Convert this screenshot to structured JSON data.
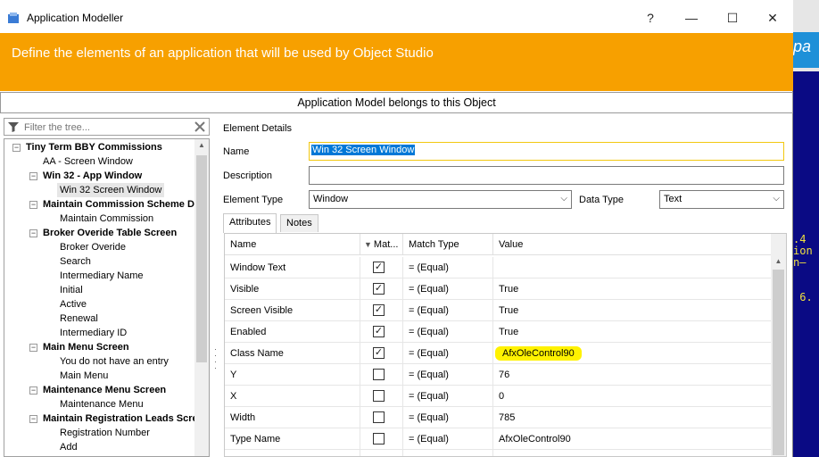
{
  "window": {
    "title": "Application Modeller",
    "help_glyph": "?",
    "minimize_glyph": "—",
    "maximize_glyph": "☐",
    "close_glyph": "✕"
  },
  "banner": {
    "text": "Define the elements of an application that will be used by Object Studio"
  },
  "belongs_bar": {
    "text": "Application Model belongs to this Object"
  },
  "tree": {
    "filter_placeholder": "Filter the tree...",
    "items": [
      {
        "label": "Tiny Term BBY Commissions",
        "level": 0,
        "bold": true,
        "expander": "−"
      },
      {
        "label": "AA - Screen Window",
        "level": 1,
        "bold": false
      },
      {
        "label": "Win 32 - App Window",
        "level": 1,
        "bold": true,
        "expander": "−"
      },
      {
        "label": "Win 32 Screen Window",
        "level": 2,
        "bold": false,
        "selected": true
      },
      {
        "label": "Maintain Commission Scheme Da",
        "level": 1,
        "bold": true,
        "expander": "−"
      },
      {
        "label": "Maintain Commission",
        "level": 2,
        "bold": false
      },
      {
        "label": "Broker Overide Table Screen",
        "level": 1,
        "bold": true,
        "expander": "−"
      },
      {
        "label": "Broker Overide",
        "level": 2,
        "bold": false
      },
      {
        "label": "Search",
        "level": 2,
        "bold": false
      },
      {
        "label": "Intermediary Name",
        "level": 2,
        "bold": false
      },
      {
        "label": "Initial",
        "level": 2,
        "bold": false
      },
      {
        "label": "Active",
        "level": 2,
        "bold": false
      },
      {
        "label": "Renewal",
        "level": 2,
        "bold": false
      },
      {
        "label": "Intermediary ID",
        "level": 2,
        "bold": false
      },
      {
        "label": "Main Menu Screen",
        "level": 1,
        "bold": true,
        "expander": "−"
      },
      {
        "label": "You do not have an entry",
        "level": 2,
        "bold": false
      },
      {
        "label": "Main Menu",
        "level": 2,
        "bold": false
      },
      {
        "label": "Maintenance Menu Screen",
        "level": 1,
        "bold": true,
        "expander": "−"
      },
      {
        "label": "Maintenance Menu",
        "level": 2,
        "bold": false
      },
      {
        "label": "Maintain Registration Leads Scre",
        "level": 1,
        "bold": true,
        "expander": "−"
      },
      {
        "label": "Registration Number",
        "level": 2,
        "bold": false
      },
      {
        "label": "Add",
        "level": 2,
        "bold": false
      }
    ]
  },
  "details": {
    "title": "Element Details",
    "name_label": "Name",
    "name_value": "Win 32 Screen Window",
    "description_label": "Description",
    "description_value": "",
    "element_type_label": "Element Type",
    "element_type_value": "Window",
    "data_type_label": "Data Type",
    "data_type_value": "Text"
  },
  "tabs": [
    {
      "label": "Attributes",
      "active": true
    },
    {
      "label": "Notes",
      "active": false
    }
  ],
  "grid": {
    "headers": {
      "name": "Name",
      "match": "Mat...",
      "match_type": "Match Type",
      "value": "Value"
    },
    "rows": [
      {
        "name": "Window Text",
        "match": true,
        "match_type": "= (Equal)",
        "value": ""
      },
      {
        "name": "Visible",
        "match": true,
        "match_type": "= (Equal)",
        "value": "True"
      },
      {
        "name": "Screen Visible",
        "match": true,
        "match_type": "= (Equal)",
        "value": "True"
      },
      {
        "name": "Enabled",
        "match": true,
        "match_type": "= (Equal)",
        "value": "True"
      },
      {
        "name": "Class Name",
        "match": true,
        "match_type": "= (Equal)",
        "value": "AfxOleControl90",
        "highlight": true
      },
      {
        "name": "Y",
        "match": false,
        "match_type": "= (Equal)",
        "value": "76"
      },
      {
        "name": "X",
        "match": false,
        "match_type": "= (Equal)",
        "value": "0"
      },
      {
        "name": "Width",
        "match": false,
        "match_type": "= (Equal)",
        "value": "785"
      },
      {
        "name": "Type Name",
        "match": false,
        "match_type": "= (Equal)",
        "value": "AfxOleControl90"
      },
      {
        "name": "",
        "match": false,
        "match_type": "",
        "value": ""
      }
    ]
  },
  "background": {
    "blue_text": "pa",
    "terminal_text": ".4\nion\nn—\n\n\n 6."
  },
  "colors": {
    "banner": "#f7a000",
    "selection": "#0078d7",
    "highlight": "#fff200"
  }
}
